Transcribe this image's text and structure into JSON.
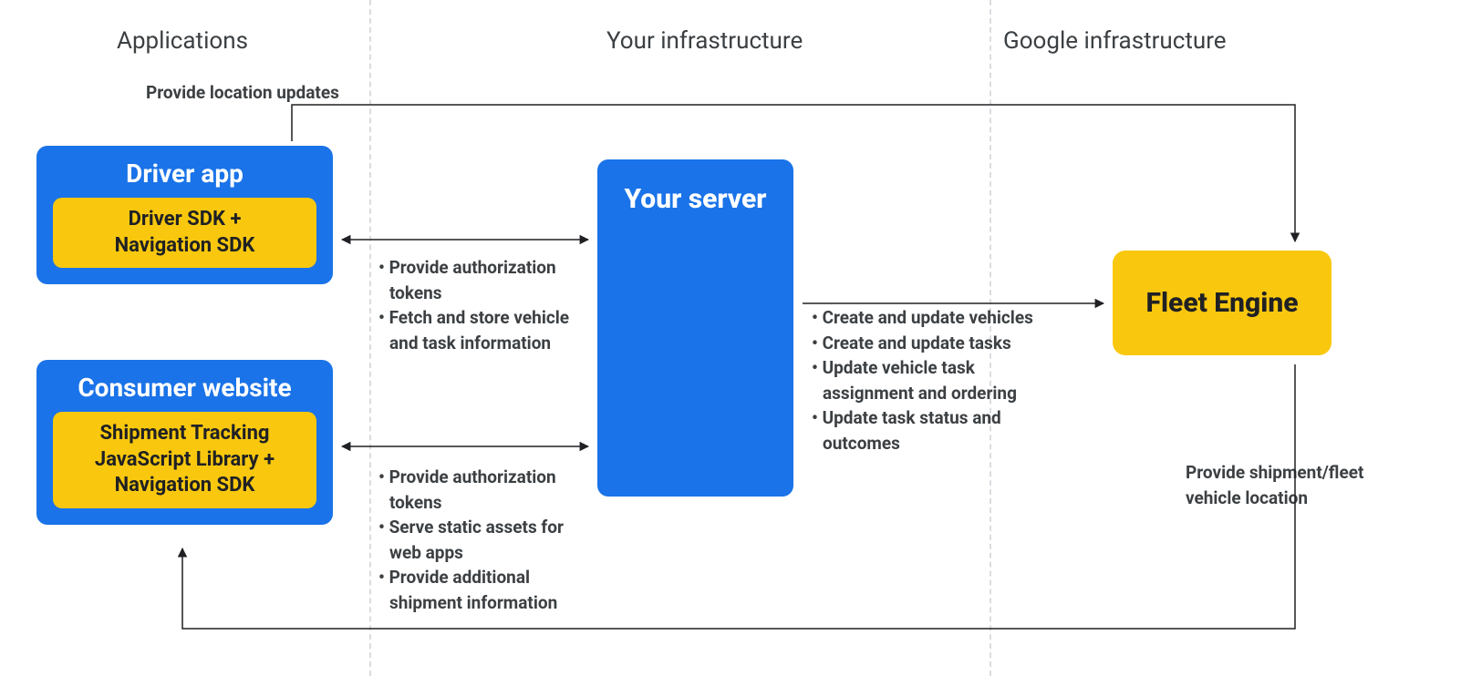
{
  "sections": {
    "applications": "Applications",
    "your_infra": "Your infrastructure",
    "google_infra": "Google infrastructure"
  },
  "nodes": {
    "driver_app": {
      "title": "Driver app",
      "sub": "Driver SDK +\nNavigation SDK"
    },
    "consumer_website": {
      "title": "Consumer website",
      "sub": "Shipment Tracking\nJavaScript Library  +\nNavigation SDK"
    },
    "your_server": "Your server",
    "fleet_engine": "Fleet Engine"
  },
  "edge_labels": {
    "top": "Provide location updates",
    "driver_server": [
      "Provide authorization tokens",
      "Fetch and store vehicle and task information"
    ],
    "consumer_server": [
      "Provide authorization tokens",
      "Serve static assets for web apps",
      "Provide additional shipment information"
    ],
    "server_fleet": [
      "Create and update vehicles",
      "Create and update tasks",
      "Update vehicle task assignment and ordering",
      "Update task status and outcomes"
    ],
    "fleet_consumer": "Provide shipment/fleet\nvehicle location"
  }
}
